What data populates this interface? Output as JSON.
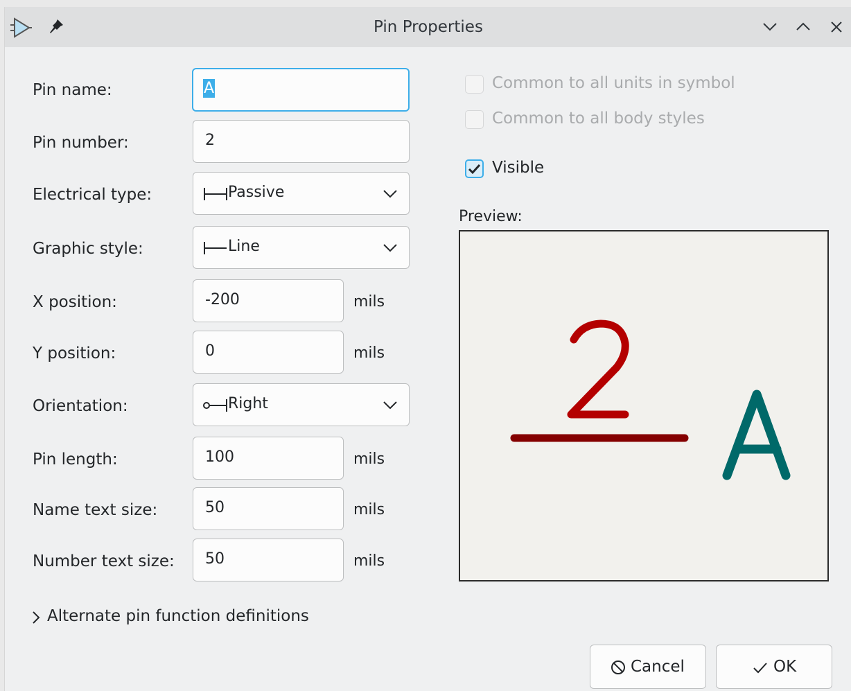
{
  "window": {
    "title": "Pin Properties"
  },
  "form": {
    "pin_name": {
      "label": "Pin name:",
      "value": "A"
    },
    "pin_number": {
      "label": "Pin number:",
      "value": "2"
    },
    "electrical_type": {
      "label": "Electrical type:",
      "value": "Passive"
    },
    "graphic_style": {
      "label": "Graphic style:",
      "value": "Line"
    },
    "x_position": {
      "label": "X position:",
      "value": "-200",
      "unit": "mils"
    },
    "y_position": {
      "label": "Y position:",
      "value": "0",
      "unit": "mils"
    },
    "orientation": {
      "label": "Orientation:",
      "value": "Right"
    },
    "pin_length": {
      "label": "Pin length:",
      "value": "100",
      "unit": "mils"
    },
    "name_text_size": {
      "label": "Name text size:",
      "value": "50",
      "unit": "mils"
    },
    "number_text_size": {
      "label": "Number text size:",
      "value": "50",
      "unit": "mils"
    }
  },
  "options": {
    "common_units": {
      "label": "Common to all units in symbol",
      "checked": false,
      "enabled": false
    },
    "common_body": {
      "label": "Common to all body styles",
      "checked": false,
      "enabled": false
    },
    "visible": {
      "label": "Visible",
      "checked": true,
      "enabled": true
    }
  },
  "preview": {
    "label": "Preview:",
    "pin_number": "2",
    "pin_name": "A"
  },
  "alternate": {
    "label": "Alternate pin function definitions"
  },
  "buttons": {
    "cancel": "Cancel",
    "ok": "OK"
  },
  "colors": {
    "accent": "#3daee9",
    "pin_number_color": "#b40000",
    "pin_line_color": "#840000",
    "pin_name_color": "#006969",
    "preview_bg": "#f2f1ed"
  },
  "icons": {
    "app": "symbol-pin-icon",
    "pin": "pin-icon",
    "minimize": "chevron-down-icon",
    "maximize": "chevron-up-icon",
    "close": "close-icon",
    "cancel": "cancel-circle-icon",
    "ok": "checkmark-icon",
    "expand": "chevron-right-icon"
  }
}
